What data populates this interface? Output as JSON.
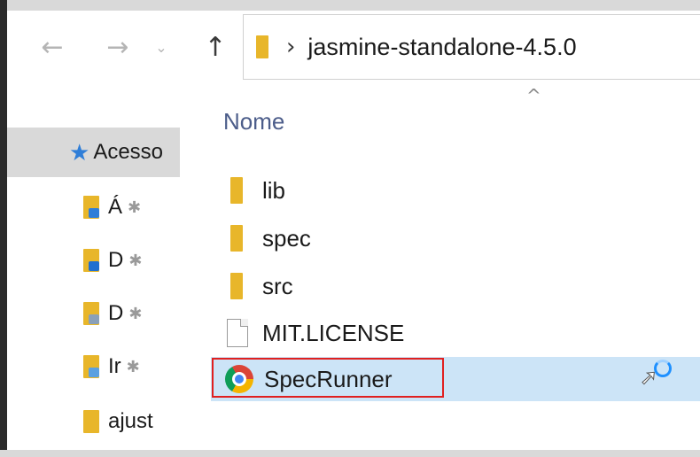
{
  "navigation": {
    "back_icon": "←",
    "forward_icon": "→",
    "recent_icon": "⌄",
    "up_icon": "↑"
  },
  "address_bar": {
    "separator": "›",
    "path": "jasmine-standalone-4.5.0"
  },
  "nav_pane": {
    "quick_access": {
      "icon": "★",
      "label": "Acesso"
    },
    "items": [
      {
        "label": "Á",
        "badge_color": "#2f7ed8",
        "pinned": "✱"
      },
      {
        "label": "D",
        "badge_color": "#1f6fd0",
        "pinned": "✱"
      },
      {
        "label": "D",
        "badge_color": "#8aa0b8",
        "pinned": "✱"
      },
      {
        "label": "Ir",
        "badge_color": "#5aa0e0",
        "pinned": "✱"
      },
      {
        "label": "ajust",
        "badge_color": "#e8b62a",
        "pinned": ""
      }
    ]
  },
  "file_list": {
    "sort_indicator": "^",
    "column_header": "Nome",
    "files": [
      {
        "name": "lib",
        "type": "folder"
      },
      {
        "name": "spec",
        "type": "folder"
      },
      {
        "name": "src",
        "type": "folder"
      },
      {
        "name": "MIT.LICENSE",
        "type": "file"
      },
      {
        "name": "SpecRunner",
        "type": "chrome-html",
        "hovered": true
      }
    ]
  },
  "colors": {
    "folder": "#e8b62a",
    "hover_row": "#cce4f7",
    "highlight_box": "#e02020",
    "quick_access_star": "#2f7ed8"
  }
}
